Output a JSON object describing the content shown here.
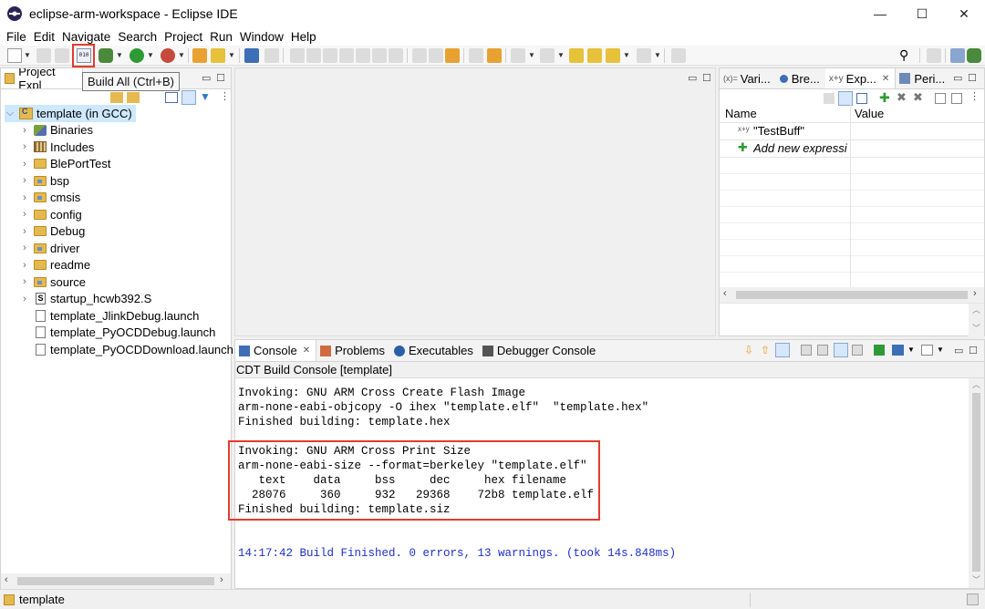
{
  "window": {
    "title": "eclipse-arm-workspace - Eclipse IDE",
    "minimize": "—",
    "maximize": "☐",
    "close": "✕"
  },
  "menu": [
    "File",
    "Edit",
    "Navigate",
    "Search",
    "Project",
    "Run",
    "Window",
    "Help"
  ],
  "tooltip": "Build All (Ctrl+B)",
  "build_icon_text": "010",
  "project_explorer": {
    "tab_label": "Project Expl",
    "items": [
      {
        "label": "template (in GCC)",
        "kind": "project",
        "expanded": true
      },
      {
        "label": "Binaries",
        "kind": "binaries"
      },
      {
        "label": "Includes",
        "kind": "includes"
      },
      {
        "label": "BlePortTest",
        "kind": "folder"
      },
      {
        "label": "bsp",
        "kind": "srcfolder"
      },
      {
        "label": "cmsis",
        "kind": "srcfolder"
      },
      {
        "label": "config",
        "kind": "folder"
      },
      {
        "label": "Debug",
        "kind": "folder"
      },
      {
        "label": "driver",
        "kind": "srcfolder"
      },
      {
        "label": "readme",
        "kind": "folder"
      },
      {
        "label": "source",
        "kind": "srcfolder"
      },
      {
        "label": "startup_hcwb392.S",
        "kind": "sfile"
      },
      {
        "label": "template_JlinkDebug.launch",
        "kind": "file"
      },
      {
        "label": "template_PyOCDDebug.launch",
        "kind": "file"
      },
      {
        "label": "template_PyOCDDownload.launch",
        "kind": "file"
      }
    ]
  },
  "debug_views": {
    "tabs": [
      "Vari...",
      "Bre...",
      "Exp...",
      "Peri..."
    ],
    "active_tab": "Exp...",
    "columns": [
      "Name",
      "Value"
    ],
    "rows": [
      {
        "name": "\"TestBuff\"",
        "value": ""
      },
      {
        "name": "Add new expressi",
        "value": ""
      }
    ]
  },
  "console_area": {
    "tabs": [
      "Console",
      "Problems",
      "Executables",
      "Debugger Console"
    ],
    "active_tab": "Console",
    "title": "CDT Build Console [template]",
    "lines": [
      "Invoking: GNU ARM Cross Create Flash Image",
      "arm-none-eabi-objcopy -O ihex \"template.elf\"  \"template.hex\"",
      "Finished building: template.hex",
      "",
      "Invoking: GNU ARM Cross Print Size",
      "arm-none-eabi-size --format=berkeley \"template.elf\"",
      "   text    data     bss     dec     hex filename",
      "  28076     360     932   29368    72b8 template.elf",
      "Finished building: template.siz",
      "",
      ""
    ],
    "final_line": "14:17:42 Build Finished. 0 errors, 13 warnings. (took 14s.848ms)"
  },
  "status_bar": {
    "text": "template"
  },
  "colors": {
    "highlight_box": "#e23b2e",
    "console_finished": "#1c30c8",
    "selection": "#cde8ff"
  }
}
